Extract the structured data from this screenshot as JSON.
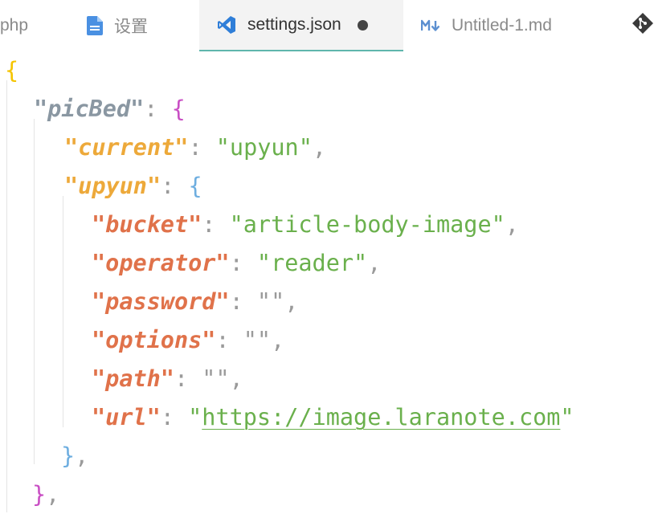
{
  "tabs": [
    {
      "label": "php",
      "active": false,
      "icon": "php-file-icon"
    },
    {
      "label": "设置",
      "active": false,
      "icon": "file-icon"
    },
    {
      "label": "settings.json",
      "active": true,
      "icon": "vscode-icon",
      "dirty": true
    },
    {
      "label": "Untitled-1.md",
      "active": false,
      "icon": "markdown-icon"
    }
  ],
  "editor": {
    "open_brace": "{",
    "picbed_key": "\"picBed\"",
    "current_key": "\"current\"",
    "current_value": "\"upyun\"",
    "upyun_key": "\"upyun\"",
    "bucket_key": "\"bucket\"",
    "bucket_value": "\"article-body-image\"",
    "operator_key": "\"operator\"",
    "operator_value": "\"reader\"",
    "password_key": "\"password\"",
    "password_value": "\"\"",
    "options_key": "\"options\"",
    "options_value": "\"\"",
    "path_key": "\"path\"",
    "path_value": "\"\"",
    "url_key": "\"url\"",
    "url_quote_open": "\"",
    "url_value": "https://image.laranote.com",
    "url_quote_close": "\"",
    "upyun_close": "}",
    "picbed_close": "}",
    "colon": ": ",
    "comma": ",",
    "brace_open": "{"
  },
  "colors": {
    "active_tab_underline": "#5fb6ac",
    "string": "#6ab04c",
    "key_level1": "#8a97a2",
    "key_level2": "#eda93a",
    "key_level3": "#e0724a",
    "bracket_yellow": "#f5c400",
    "bracket_purple": "#c94fc4",
    "bracket_blue": "#6eaee0"
  }
}
